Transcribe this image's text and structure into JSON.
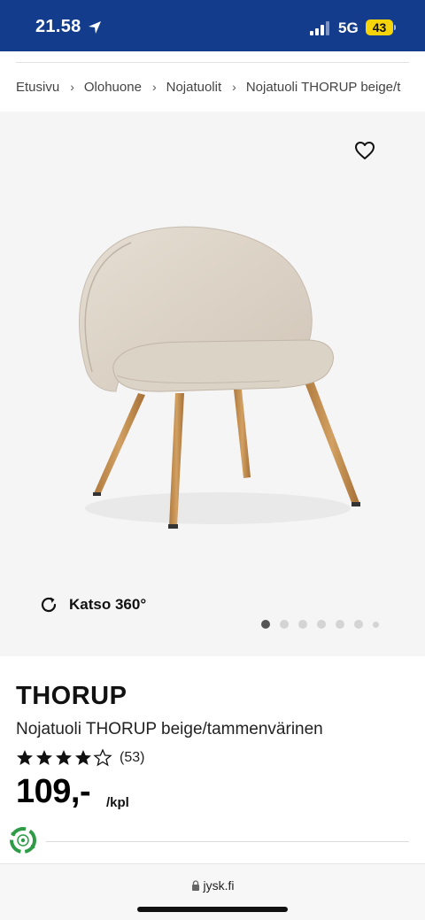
{
  "status_bar": {
    "time": "21.58",
    "network": "5G",
    "battery": "43",
    "icons": [
      "location-arrow-icon",
      "signal-icon",
      "battery-icon"
    ]
  },
  "breadcrumb": {
    "items": [
      "Etusivu",
      "Olohuone",
      "Nojatuolit",
      "Nojatuoli THORUP beige/t"
    ],
    "separator": "›"
  },
  "gallery": {
    "view360_label": "Katso 360°",
    "image_count": 7,
    "active_index": 0
  },
  "product": {
    "title": "THORUP",
    "description": "Nojatuoli THORUP beige/tammenvärinen",
    "rating": 4.5,
    "review_count": "(53)",
    "price": "109,-",
    "unit": "/kpl"
  },
  "browser": {
    "url": "jysk.fi"
  },
  "colors": {
    "status_bar": "#143c8c",
    "battery": "#f5d50a",
    "gallery_bg": "#f5f5f5",
    "eco_green": "#2e9b46"
  }
}
